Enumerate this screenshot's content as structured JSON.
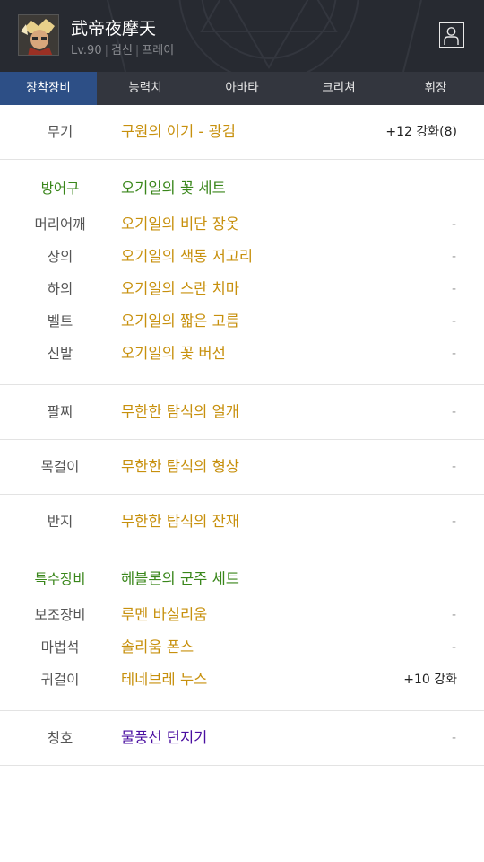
{
  "character": {
    "name": "武帝夜摩天",
    "level": "Lv.90",
    "job": "검신",
    "server": "프레이"
  },
  "tabs": [
    "장착장비",
    "능력치",
    "아바타",
    "크리쳐",
    "휘장"
  ],
  "active_tab": "장착장비",
  "equipment": {
    "weapon": {
      "label": "무기",
      "item": "구원의 이기 - 광검",
      "value": "+12 강화(8)"
    },
    "armor_set": {
      "label": "방어구",
      "set_name": "오기일의 꽃 세트"
    },
    "armor": [
      {
        "label": "머리어깨",
        "item": "오기일의 비단 장옷",
        "value": "-"
      },
      {
        "label": "상의",
        "item": "오기일의 색동 저고리",
        "value": "-"
      },
      {
        "label": "하의",
        "item": "오기일의 스란 치마",
        "value": "-"
      },
      {
        "label": "벨트",
        "item": "오기일의 짧은 고름",
        "value": "-"
      },
      {
        "label": "신발",
        "item": "오기일의 꽃 버선",
        "value": "-"
      }
    ],
    "bracelet": {
      "label": "팔찌",
      "item": "무한한 탐식의 얼개",
      "value": "-"
    },
    "necklace": {
      "label": "목걸이",
      "item": "무한한 탐식의 형상",
      "value": "-"
    },
    "ring": {
      "label": "반지",
      "item": "무한한 탐식의 잔재",
      "value": "-"
    },
    "special_set": {
      "label": "특수장비",
      "set_name": "헤블론의 군주 세트"
    },
    "special": [
      {
        "label": "보조장비",
        "item": "루멘 바실리움",
        "value": "-"
      },
      {
        "label": "마법석",
        "item": "솔리움 폰스",
        "value": "-"
      },
      {
        "label": "귀걸이",
        "item": "테네브레 누스",
        "value": "+10 강화"
      }
    ],
    "title": {
      "label": "칭호",
      "item": "물풍선 던지기",
      "value": "-"
    }
  },
  "colors": {
    "header_bg": "#272a31",
    "tab_bar_bg": "#33363e",
    "tab_active_bg": "#2d4f86",
    "item_gold": "#c7900d",
    "set_green": "#39861a",
    "title_purple": "#4a0fa0",
    "divider": "#e3e3e3"
  },
  "icons": {
    "avatar": "character-portrait",
    "profile": "person-outline-icon"
  }
}
